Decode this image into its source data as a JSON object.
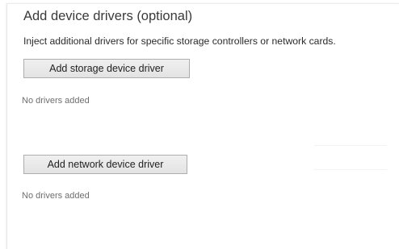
{
  "drivers_section": {
    "title": "Add device drivers (optional)",
    "description": "Inject additional drivers for specific storage controllers or network cards.",
    "storage": {
      "button_label": "Add storage device driver",
      "status": "No drivers added"
    },
    "network": {
      "button_label": "Add network device driver",
      "status": "No drivers added"
    }
  },
  "colors": {
    "background": "#ffffff",
    "text": "#3a3a3a",
    "muted_text": "#6e6e6e",
    "button_face": "#e8e8e8",
    "button_border": "#adadad"
  }
}
